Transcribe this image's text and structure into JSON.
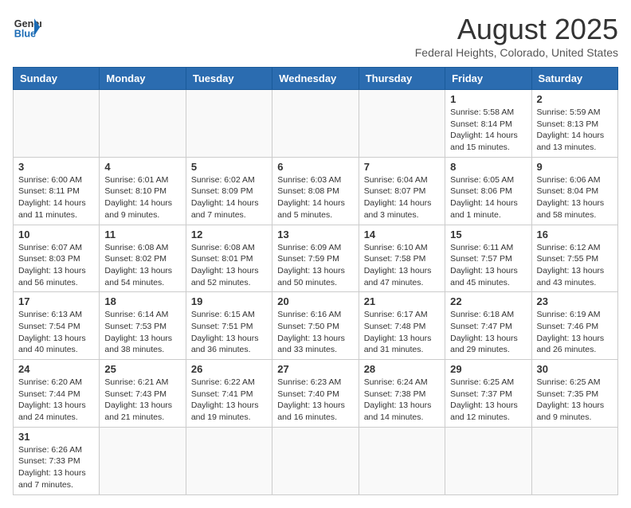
{
  "header": {
    "logo_general": "General",
    "logo_blue": "Blue",
    "title": "August 2025",
    "subtitle": "Federal Heights, Colorado, United States"
  },
  "weekdays": [
    "Sunday",
    "Monday",
    "Tuesday",
    "Wednesday",
    "Thursday",
    "Friday",
    "Saturday"
  ],
  "weeks": [
    [
      {
        "day": "",
        "info": ""
      },
      {
        "day": "",
        "info": ""
      },
      {
        "day": "",
        "info": ""
      },
      {
        "day": "",
        "info": ""
      },
      {
        "day": "",
        "info": ""
      },
      {
        "day": "1",
        "info": "Sunrise: 5:58 AM\nSunset: 8:14 PM\nDaylight: 14 hours and 15 minutes."
      },
      {
        "day": "2",
        "info": "Sunrise: 5:59 AM\nSunset: 8:13 PM\nDaylight: 14 hours and 13 minutes."
      }
    ],
    [
      {
        "day": "3",
        "info": "Sunrise: 6:00 AM\nSunset: 8:11 PM\nDaylight: 14 hours and 11 minutes."
      },
      {
        "day": "4",
        "info": "Sunrise: 6:01 AM\nSunset: 8:10 PM\nDaylight: 14 hours and 9 minutes."
      },
      {
        "day": "5",
        "info": "Sunrise: 6:02 AM\nSunset: 8:09 PM\nDaylight: 14 hours and 7 minutes."
      },
      {
        "day": "6",
        "info": "Sunrise: 6:03 AM\nSunset: 8:08 PM\nDaylight: 14 hours and 5 minutes."
      },
      {
        "day": "7",
        "info": "Sunrise: 6:04 AM\nSunset: 8:07 PM\nDaylight: 14 hours and 3 minutes."
      },
      {
        "day": "8",
        "info": "Sunrise: 6:05 AM\nSunset: 8:06 PM\nDaylight: 14 hours and 1 minute."
      },
      {
        "day": "9",
        "info": "Sunrise: 6:06 AM\nSunset: 8:04 PM\nDaylight: 13 hours and 58 minutes."
      }
    ],
    [
      {
        "day": "10",
        "info": "Sunrise: 6:07 AM\nSunset: 8:03 PM\nDaylight: 13 hours and 56 minutes."
      },
      {
        "day": "11",
        "info": "Sunrise: 6:08 AM\nSunset: 8:02 PM\nDaylight: 13 hours and 54 minutes."
      },
      {
        "day": "12",
        "info": "Sunrise: 6:08 AM\nSunset: 8:01 PM\nDaylight: 13 hours and 52 minutes."
      },
      {
        "day": "13",
        "info": "Sunrise: 6:09 AM\nSunset: 7:59 PM\nDaylight: 13 hours and 50 minutes."
      },
      {
        "day": "14",
        "info": "Sunrise: 6:10 AM\nSunset: 7:58 PM\nDaylight: 13 hours and 47 minutes."
      },
      {
        "day": "15",
        "info": "Sunrise: 6:11 AM\nSunset: 7:57 PM\nDaylight: 13 hours and 45 minutes."
      },
      {
        "day": "16",
        "info": "Sunrise: 6:12 AM\nSunset: 7:55 PM\nDaylight: 13 hours and 43 minutes."
      }
    ],
    [
      {
        "day": "17",
        "info": "Sunrise: 6:13 AM\nSunset: 7:54 PM\nDaylight: 13 hours and 40 minutes."
      },
      {
        "day": "18",
        "info": "Sunrise: 6:14 AM\nSunset: 7:53 PM\nDaylight: 13 hours and 38 minutes."
      },
      {
        "day": "19",
        "info": "Sunrise: 6:15 AM\nSunset: 7:51 PM\nDaylight: 13 hours and 36 minutes."
      },
      {
        "day": "20",
        "info": "Sunrise: 6:16 AM\nSunset: 7:50 PM\nDaylight: 13 hours and 33 minutes."
      },
      {
        "day": "21",
        "info": "Sunrise: 6:17 AM\nSunset: 7:48 PM\nDaylight: 13 hours and 31 minutes."
      },
      {
        "day": "22",
        "info": "Sunrise: 6:18 AM\nSunset: 7:47 PM\nDaylight: 13 hours and 29 minutes."
      },
      {
        "day": "23",
        "info": "Sunrise: 6:19 AM\nSunset: 7:46 PM\nDaylight: 13 hours and 26 minutes."
      }
    ],
    [
      {
        "day": "24",
        "info": "Sunrise: 6:20 AM\nSunset: 7:44 PM\nDaylight: 13 hours and 24 minutes."
      },
      {
        "day": "25",
        "info": "Sunrise: 6:21 AM\nSunset: 7:43 PM\nDaylight: 13 hours and 21 minutes."
      },
      {
        "day": "26",
        "info": "Sunrise: 6:22 AM\nSunset: 7:41 PM\nDaylight: 13 hours and 19 minutes."
      },
      {
        "day": "27",
        "info": "Sunrise: 6:23 AM\nSunset: 7:40 PM\nDaylight: 13 hours and 16 minutes."
      },
      {
        "day": "28",
        "info": "Sunrise: 6:24 AM\nSunset: 7:38 PM\nDaylight: 13 hours and 14 minutes."
      },
      {
        "day": "29",
        "info": "Sunrise: 6:25 AM\nSunset: 7:37 PM\nDaylight: 13 hours and 12 minutes."
      },
      {
        "day": "30",
        "info": "Sunrise: 6:25 AM\nSunset: 7:35 PM\nDaylight: 13 hours and 9 minutes."
      }
    ],
    [
      {
        "day": "31",
        "info": "Sunrise: 6:26 AM\nSunset: 7:33 PM\nDaylight: 13 hours and 7 minutes."
      },
      {
        "day": "",
        "info": ""
      },
      {
        "day": "",
        "info": ""
      },
      {
        "day": "",
        "info": ""
      },
      {
        "day": "",
        "info": ""
      },
      {
        "day": "",
        "info": ""
      },
      {
        "day": "",
        "info": ""
      }
    ]
  ]
}
